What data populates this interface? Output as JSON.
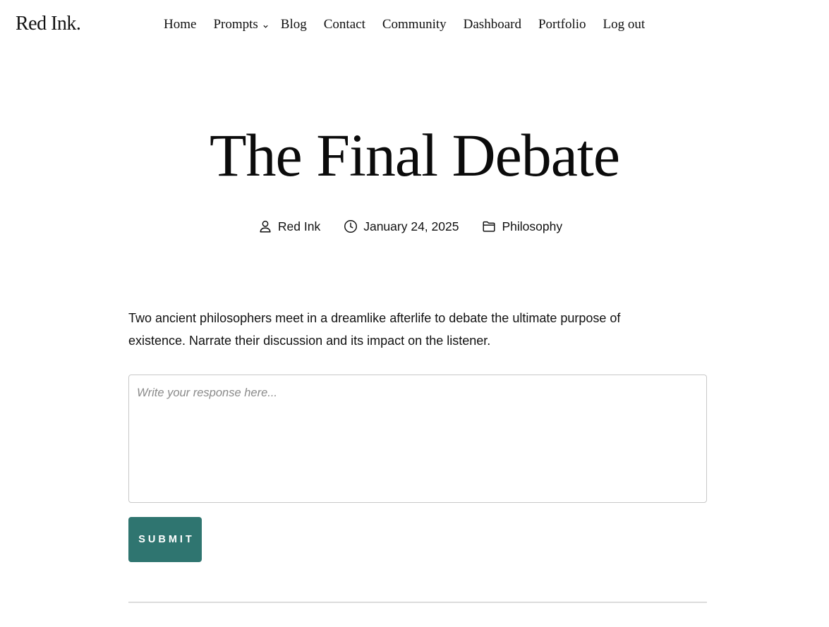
{
  "site": {
    "logo": "Red Ink."
  },
  "nav": {
    "items": [
      {
        "label": "Home"
      },
      {
        "label": "Prompts",
        "has_dropdown": true
      },
      {
        "label": "Blog"
      },
      {
        "label": "Contact"
      },
      {
        "label": "Community"
      },
      {
        "label": "Dashboard"
      },
      {
        "label": "Portfolio"
      },
      {
        "label": "Log out"
      }
    ]
  },
  "post": {
    "title": "The Final Debate",
    "meta": {
      "author": "Red Ink",
      "date": "January 24, 2025",
      "category": "Philosophy"
    },
    "prompt": "Two ancient philosophers meet in a dreamlike afterlife to debate the ultimate purpose of existence. Narrate their discussion and its impact on the listener."
  },
  "form": {
    "response_placeholder": "Write your response here...",
    "response_value": "",
    "submit_label": "SUBMIT"
  },
  "colors": {
    "accent": "#2f7570",
    "text": "#111111",
    "border": "#c8c8c8",
    "divider": "#dcdcdc"
  },
  "icons": {
    "author": "user-icon",
    "date": "clock-icon",
    "category": "folder-icon",
    "dropdown": "chevron-down-icon"
  }
}
